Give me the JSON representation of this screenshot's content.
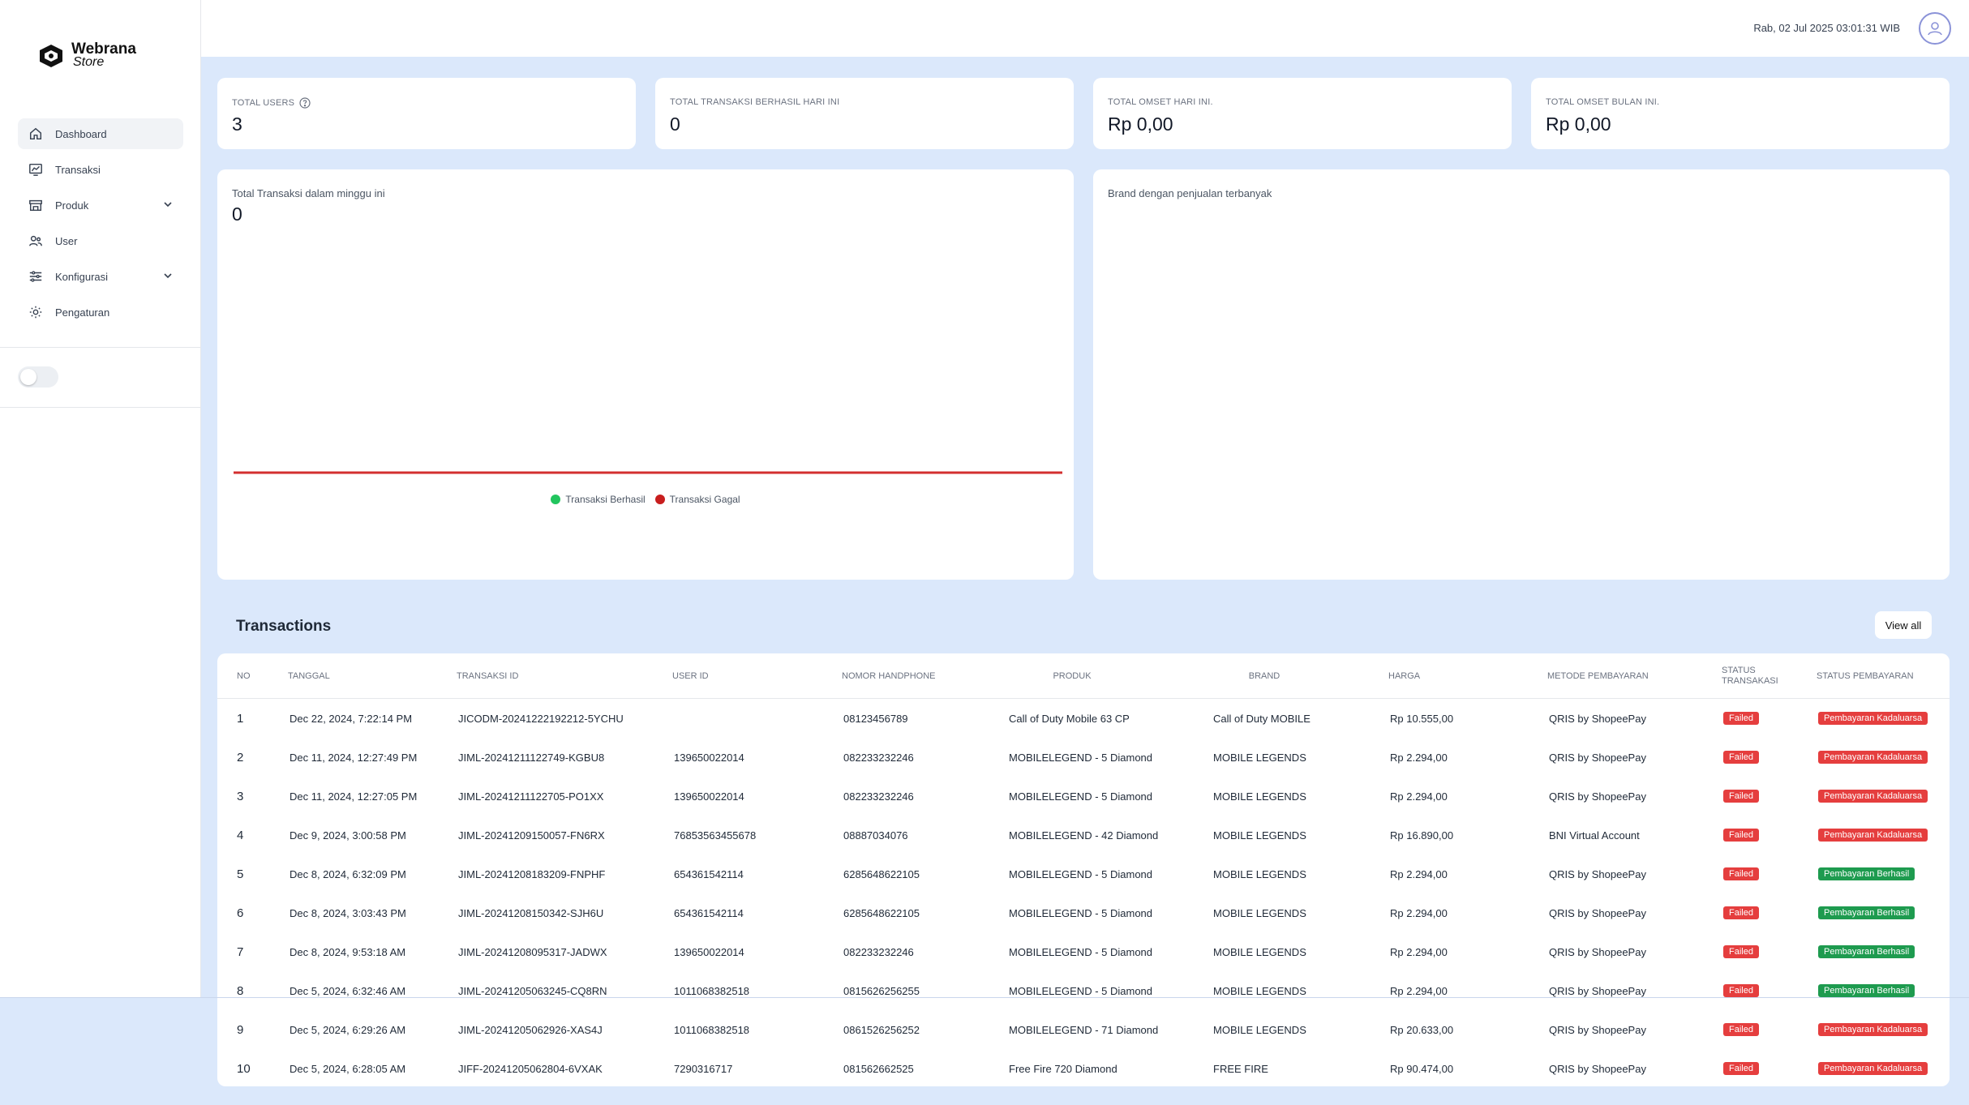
{
  "brand": {
    "name_line1": "Webrana",
    "name_line2": "Store"
  },
  "sidebar": {
    "items": [
      {
        "label": "Dashboard",
        "icon": "home-icon",
        "active": true
      },
      {
        "label": "Transaksi",
        "icon": "chart-icon"
      },
      {
        "label": "Produk",
        "icon": "store-icon",
        "has_children": true
      },
      {
        "label": "User",
        "icon": "users-icon"
      },
      {
        "label": "Konfigurasi",
        "icon": "sliders-icon",
        "has_children": true
      },
      {
        "label": "Pengaturan",
        "icon": "gear-icon"
      }
    ]
  },
  "header": {
    "datetime": "Rab, 02 Jul 2025 03:01:31 WIB"
  },
  "stats": [
    {
      "label": "TOTAL USERS",
      "value": "3"
    },
    {
      "label": "TOTAL TRANSAKSI BERHASIL HARI INI",
      "value": "0"
    },
    {
      "label": "TOTAL OMSET HARI INI.",
      "value": "Rp 0,00"
    },
    {
      "label": "TOTAL OMSET BULAN INI.",
      "value": "Rp 0,00"
    }
  ],
  "weekly_chart": {
    "title": "Total Transaksi dalam minggu ini",
    "total": "0",
    "legend": [
      {
        "name": "Transaksi Berhasil",
        "color": "#22c55e"
      },
      {
        "name": "Transaksi Gagal",
        "color": "#c81e1e"
      }
    ],
    "line_color": "#d32f2f"
  },
  "brand_chart": {
    "title": "Brand dengan penjualan terbanyak"
  },
  "transactions": {
    "title": "Transactions",
    "view_all": "View all",
    "columns": [
      "NO",
      "TANGGAL",
      "TRANSAKSI ID",
      "USER ID",
      "NOMOR HANDPHONE",
      "PRODUK",
      "BRAND",
      "HARGA",
      "METODE PEMBAYARAN",
      "STATUS TRANSAKASI",
      "STATUS PEMBAYARAN"
    ],
    "rows": [
      [
        "1",
        "Dec 22, 2024, 7:22:14 PM",
        "JICODM-20241222192212-5YCHU",
        "",
        "08123456789",
        "Call of Duty Mobile 63 CP",
        "Call of Duty MOBILE",
        "Rp 10.555,00",
        "QRIS by ShopeePay",
        "Failed",
        "Pembayaran Kadaluarsa"
      ],
      [
        "2",
        "Dec 11, 2024, 12:27:49 PM",
        "JIML-20241211122749-KGBU8",
        "139650022014",
        "082233232246",
        "MOBILELEGEND - 5 Diamond",
        "MOBILE LEGENDS",
        "Rp 2.294,00",
        "QRIS by ShopeePay",
        "Failed",
        "Pembayaran Kadaluarsa"
      ],
      [
        "3",
        "Dec 11, 2024, 12:27:05 PM",
        "JIML-20241211122705-PO1XX",
        "139650022014",
        "082233232246",
        "MOBILELEGEND - 5 Diamond",
        "MOBILE LEGENDS",
        "Rp 2.294,00",
        "QRIS by ShopeePay",
        "Failed",
        "Pembayaran Kadaluarsa"
      ],
      [
        "4",
        "Dec 9, 2024, 3:00:58 PM",
        "JIML-20241209150057-FN6RX",
        "76853563455678",
        "08887034076",
        "MOBILELEGEND - 42 Diamond",
        "MOBILE LEGENDS",
        "Rp 16.890,00",
        "BNI Virtual Account",
        "Failed",
        "Pembayaran Kadaluarsa"
      ],
      [
        "5",
        "Dec 8, 2024, 6:32:09 PM",
        "JIML-20241208183209-FNPHF",
        "654361542114",
        "6285648622105",
        "MOBILELEGEND - 5 Diamond",
        "MOBILE LEGENDS",
        "Rp 2.294,00",
        "QRIS by ShopeePay",
        "Failed",
        "Pembayaran Berhasil"
      ],
      [
        "6",
        "Dec 8, 2024, 3:03:43 PM",
        "JIML-20241208150342-SJH6U",
        "654361542114",
        "6285648622105",
        "MOBILELEGEND - 5 Diamond",
        "MOBILE LEGENDS",
        "Rp 2.294,00",
        "QRIS by ShopeePay",
        "Failed",
        "Pembayaran Berhasil"
      ],
      [
        "7",
        "Dec 8, 2024, 9:53:18 AM",
        "JIML-20241208095317-JADWX",
        "139650022014",
        "082233232246",
        "MOBILELEGEND - 5 Diamond",
        "MOBILE LEGENDS",
        "Rp 2.294,00",
        "QRIS by ShopeePay",
        "Failed",
        "Pembayaran Berhasil"
      ],
      [
        "8",
        "Dec 5, 2024, 6:32:46 AM",
        "JIML-20241205063245-CQ8RN",
        "1011068382518",
        "0815626256255",
        "MOBILELEGEND - 5 Diamond",
        "MOBILE LEGENDS",
        "Rp 2.294,00",
        "QRIS by ShopeePay",
        "Failed",
        "Pembayaran Berhasil"
      ],
      [
        "9",
        "Dec 5, 2024, 6:29:26 AM",
        "JIML-20241205062926-XAS4J",
        "1011068382518",
        "0861526256252",
        "MOBILELEGEND - 71 Diamond",
        "MOBILE LEGENDS",
        "Rp 20.633,00",
        "QRIS by ShopeePay",
        "Failed",
        "Pembayaran Kadaluarsa"
      ],
      [
        "10",
        "Dec 5, 2024, 6:28:05 AM",
        "JIFF-20241205062804-6VXAK",
        "7290316717",
        "081562662525",
        "Free Fire 720 Diamond",
        "FREE FIRE",
        "Rp 90.474,00",
        "QRIS by ShopeePay",
        "Failed",
        "Pembayaran Kadaluarsa"
      ]
    ]
  }
}
